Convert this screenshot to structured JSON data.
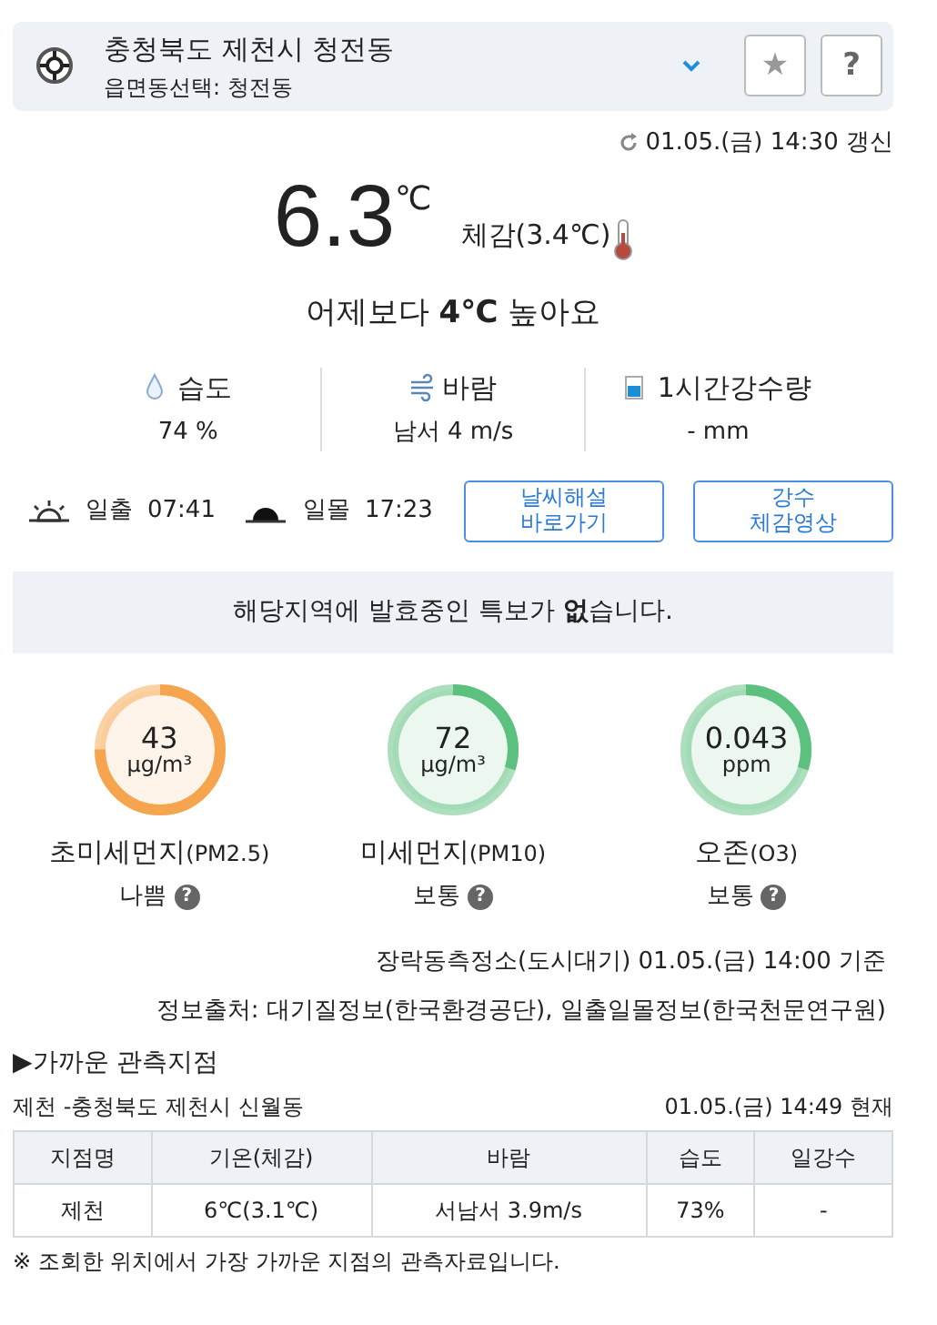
{
  "location": {
    "title": "충청북도 제천시 청전동",
    "subtitle": "읍면동선택: 청전동",
    "star_label": "★",
    "help_label": "?"
  },
  "updated": "01.05.(금) 14:30 갱신",
  "current": {
    "temperature": "6.3",
    "unit": "℃",
    "feels_like": "체감(3.4℃)",
    "compare": "어제보다 **4℃** 높아요"
  },
  "stats": [
    {
      "kind": "humidity",
      "label": "습도",
      "value": "74 %"
    },
    {
      "kind": "wind",
      "label": "바람",
      "value": "남서 4 m/s"
    },
    {
      "kind": "rain",
      "label": "1시간강수량",
      "value": "- mm"
    }
  ],
  "sun": [
    {
      "kind": "sunrise",
      "label": "일출",
      "time": "07:41"
    },
    {
      "kind": "sunset",
      "label": "일몰",
      "time": "17:23"
    }
  ],
  "links": [
    [
      "날씨해설",
      "바로가기"
    ],
    [
      "강수",
      "체감영상"
    ]
  ],
  "alert": "해당지역에 발효중인 특보가 **없**습니다.",
  "air": [
    {
      "value": "43",
      "unit": "μg/m³",
      "name": "초미세먼지",
      "code": "(PM2.5)",
      "grade": "나쁨",
      "color": "#f5a54e",
      "level": 0.75
    },
    {
      "value": "72",
      "unit": "μg/m³",
      "name": "미세먼지",
      "code": "(PM10)",
      "grade": "보통",
      "color": "#5cc07f",
      "level": 0.3
    },
    {
      "value": "0.043",
      "unit": "ppm",
      "name": "오존",
      "code": "(O3)",
      "grade": "보통",
      "color": "#5cc07f",
      "level": 0.3
    }
  ],
  "air_station": "장락동측정소(도시대기) 01.05.(금) 14:00 기준",
  "source": "정보출처: 대기질정보(한국환경공단), 일출일몰정보(한국천문연구원)",
  "nearby": {
    "title": "▶가까운 관측지점",
    "station": "제천 -충청북도 제천시 신월동",
    "time": "01.05.(금) 14:49 현재",
    "columns": [
      "지점명",
      "기온(체감)",
      "바람",
      "습도",
      "일강수"
    ],
    "rows": [
      [
        "제천",
        "6℃(3.1℃)",
        "서남서 3.9m/s",
        "73%",
        "-"
      ]
    ],
    "note": "※ 조회한 위치에서 가장 가까운 지점의 관측자료입니다."
  }
}
